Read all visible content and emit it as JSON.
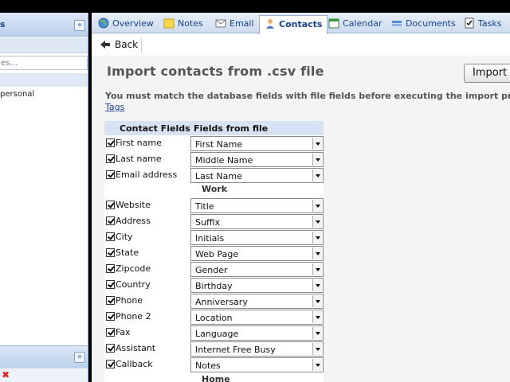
{
  "sidebar": {
    "header_label": "s",
    "collapse_glyph": "«",
    "search_placeholder": "es...",
    "personal_label": "personal",
    "expand_glyph": "»",
    "delete_glyph": "✖"
  },
  "tabs": [
    {
      "label": "Overview",
      "icon": "globe-icon"
    },
    {
      "label": "Notes",
      "icon": "note-icon"
    },
    {
      "label": "Email",
      "icon": "envelope-icon"
    },
    {
      "label": "Contacts",
      "icon": "person-icon",
      "active": true
    },
    {
      "label": "Calendar",
      "icon": "calendar-icon"
    },
    {
      "label": "Documents",
      "icon": "documents-icon"
    },
    {
      "label": "Tasks",
      "icon": "tasks-icon"
    }
  ],
  "toolbar": {
    "back_label": "Back"
  },
  "page": {
    "title": "Import contacts from .csv file",
    "import_label": "Import",
    "hint": "You must match the database fields with file fields before executing the import proc",
    "tags_link": "Tags"
  },
  "mapping": {
    "col_contact": "Contact Fields",
    "col_file": "Fields from file",
    "rows_top": [
      {
        "field": "First name",
        "file": "First Name",
        "checked": true
      },
      {
        "field": "Last name",
        "file": "Middle Name",
        "checked": true
      },
      {
        "field": "Email address",
        "file": "Last Name",
        "checked": true
      }
    ],
    "group_work": "Work",
    "rows_work": [
      {
        "field": "Website",
        "file": "Title",
        "checked": true
      },
      {
        "field": "Address",
        "file": "Suffix",
        "checked": true
      },
      {
        "field": "City",
        "file": "Initials",
        "checked": true
      },
      {
        "field": "State",
        "file": "Web Page",
        "checked": true
      },
      {
        "field": "Zipcode",
        "file": "Gender",
        "checked": true
      },
      {
        "field": "Country",
        "file": "Birthday",
        "checked": true
      },
      {
        "field": "Phone",
        "file": "Anniversary",
        "checked": true
      },
      {
        "field": "Phone 2",
        "file": "Location",
        "checked": true
      },
      {
        "field": "Fax",
        "file": "Language",
        "checked": true
      },
      {
        "field": "Assistant",
        "file": "Internet Free Busy",
        "checked": true
      },
      {
        "field": "Callback",
        "file": "Notes",
        "checked": true
      }
    ],
    "group_home": "Home"
  },
  "colors": {
    "accent": "#15428b",
    "tab_bar": "#cfdcee",
    "header_blue": "#d6e3f3"
  }
}
